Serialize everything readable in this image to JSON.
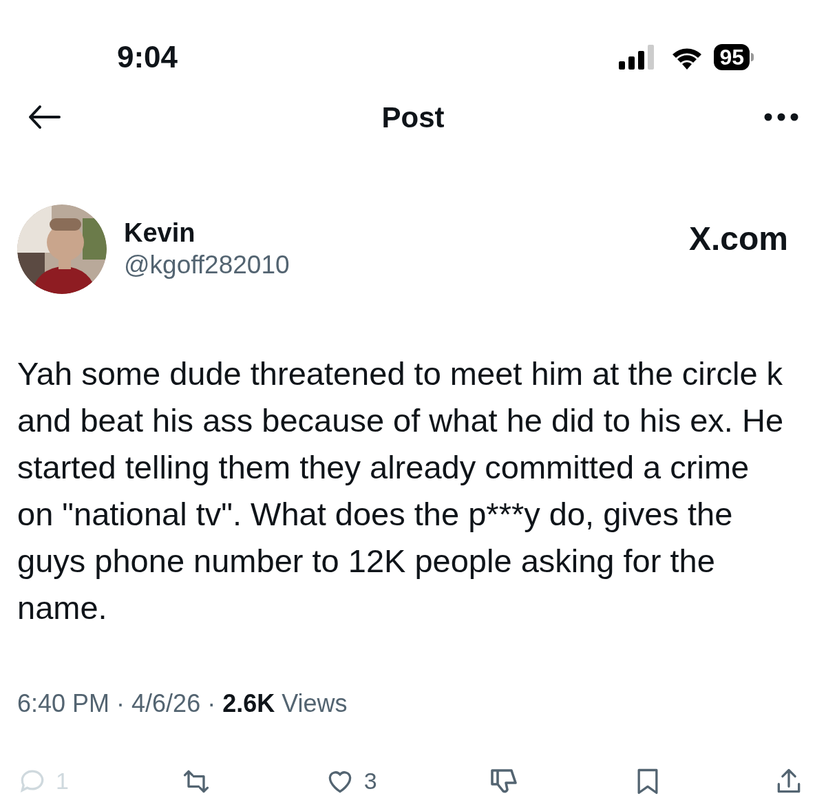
{
  "status_bar": {
    "time": "9:04",
    "battery": "95"
  },
  "header": {
    "title": "Post"
  },
  "post": {
    "author": "Kevin",
    "handle": "@kgoff282010",
    "source": "X.com",
    "text": "Yah some dude threatened to meet him at the circle k and beat his ass because of what he did to his ex. He started telling them they already committed a crime on \"national tv\". What does the p***y do, gives the guys phone number to 12K people asking for the name.",
    "meta": "6:40 PM · 4/6/26 · **2.6K** Views"
  },
  "actions": [
    {
      "kind": "reply",
      "count": "1",
      "dimmed": true
    },
    {
      "kind": "repost",
      "dimmed": false
    },
    {
      "kind": "like",
      "count": "3",
      "dimmed": false
    },
    {
      "kind": "dislike",
      "dimmed": false
    },
    {
      "kind": "bookmark",
      "dimmed": false
    },
    {
      "kind": "share",
      "dimmed": false
    }
  ]
}
